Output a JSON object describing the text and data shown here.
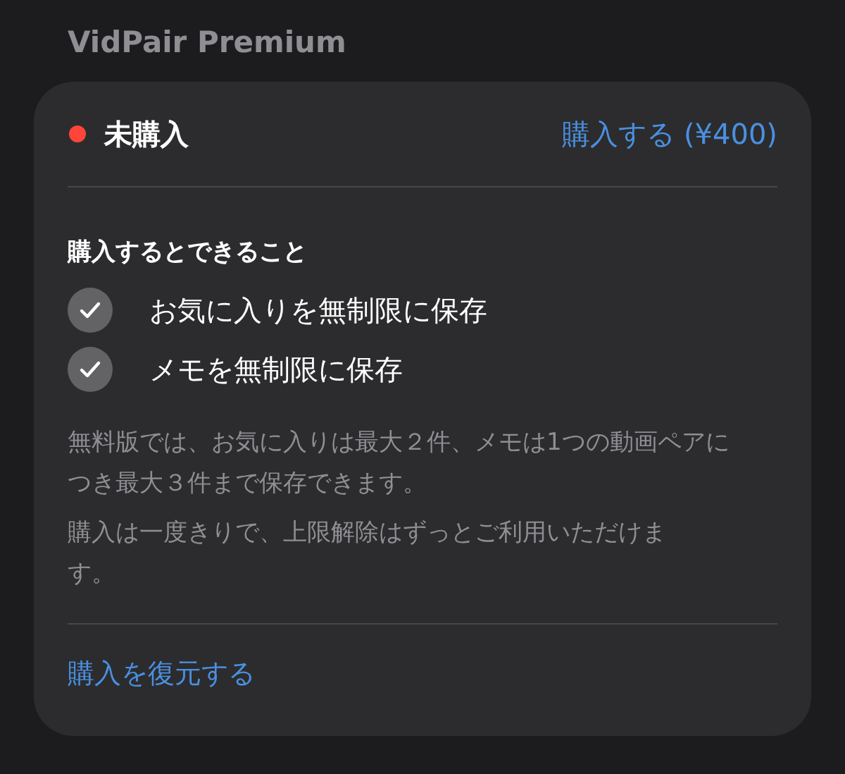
{
  "section_title": "VidPair Premium",
  "status": {
    "label": "未購入",
    "purchased": false
  },
  "buy_link": "購入する (¥400)",
  "features_title": "購入するとできること",
  "features": [
    {
      "label": "お気に入りを無制限に保存",
      "checked": true
    },
    {
      "label": "メモを無制限に保存",
      "checked": true
    }
  ],
  "notes": [
    "無料版では、お気に入りは最大２件、メモは1つの動画ペアにつき最大３件まで保存できます。",
    "購入は一度きりで、上限解除はずっとご利用いただけます。"
  ],
  "restore_link": "購入を復元する"
}
